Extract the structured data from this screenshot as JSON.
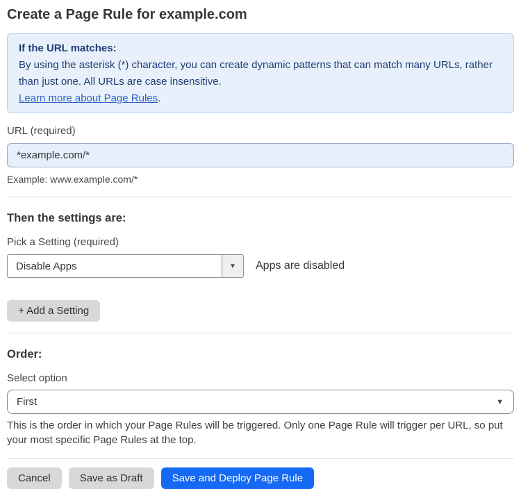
{
  "page": {
    "title": "Create a Page Rule for example.com"
  },
  "info_box": {
    "heading": "If the URL matches:",
    "body": "By using the asterisk (*) character, you can create dynamic patterns that can match many URLs, rather than just one. All URLs are case insensitive.",
    "link_label": "Learn more about Page Rules",
    "link_suffix": "."
  },
  "url_field": {
    "label": "URL (required)",
    "value": "*example.com/*",
    "helper": "Example: www.example.com/*"
  },
  "settings_section": {
    "heading": "Then the settings are:",
    "setting_label": "Pick a Setting (required)",
    "setting_value": "Disable Apps",
    "setting_status": "Apps are disabled",
    "add_setting_label": "+ Add a Setting"
  },
  "order_section": {
    "heading": "Order:",
    "select_label": "Select option",
    "select_value": "First",
    "helper": "This is the order in which your Page Rules will be triggered. Only one Page Rule will trigger per URL, so put your most specific Page Rules at the top."
  },
  "actions": {
    "cancel_label": "Cancel",
    "save_draft_label": "Save as Draft",
    "save_deploy_label": "Save and Deploy Page Rule"
  },
  "icons": {
    "dropdown_arrow": "▼"
  },
  "colors": {
    "accent_blue": "#1569f3",
    "info_background": "#e8f1fb",
    "info_border": "#b7d0ee",
    "info_text": "#1f3c74",
    "link_blue": "#2c5fc7",
    "input_background": "#e7effc",
    "button_gray": "#d8d8d8"
  }
}
